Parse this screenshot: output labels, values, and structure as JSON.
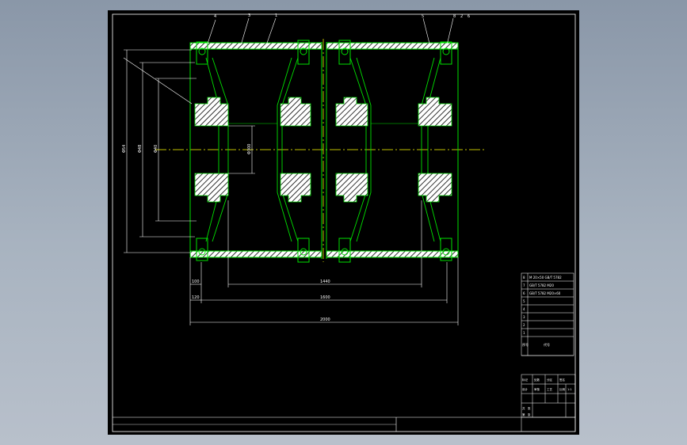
{
  "drawing": {
    "background_color": "#000000",
    "outer_background_color": "#9aa5b4",
    "border_color": "#ffffff",
    "part_color": "#00e000",
    "dimension_color": "#ffffff",
    "centerline_color": "#ffff00",
    "leader_color": "#ffffff",
    "balloons_left": [
      "4",
      "3",
      "1"
    ],
    "balloons_right": [
      "5",
      "8",
      "2",
      "6"
    ],
    "dimensions": {
      "vertical_outer": "Φ54",
      "vertical_mid": "Φ48",
      "vertical_inner": "Φ40",
      "vertical_hub": "Φ300",
      "horizontal_inner": "1440",
      "horizontal_mid": "1600",
      "horizontal_total": "2000",
      "horizontal_left_small": "100",
      "horizontal_left_offset": "120"
    }
  },
  "parts_list": {
    "header_seq": "序号",
    "header_code": "代号",
    "rows": [
      {
        "seq": "8",
        "text": "M 20×50 GB/T 5782"
      },
      {
        "seq": "7",
        "text": "GB/T 5782 M20"
      },
      {
        "seq": "6",
        "text": "GB/T 5782 M20×60"
      },
      {
        "seq": "5",
        "text": ""
      },
      {
        "seq": "4",
        "text": ""
      },
      {
        "seq": "3",
        "text": ""
      },
      {
        "seq": "2",
        "text": ""
      },
      {
        "seq": "1",
        "text": ""
      }
    ]
  },
  "title_block": {
    "cells": [
      "标记",
      "处数",
      "分区",
      "签名",
      "设计",
      "审核",
      "工艺",
      "比例",
      "1:1",
      "共",
      "张",
      "第",
      "张"
    ]
  }
}
